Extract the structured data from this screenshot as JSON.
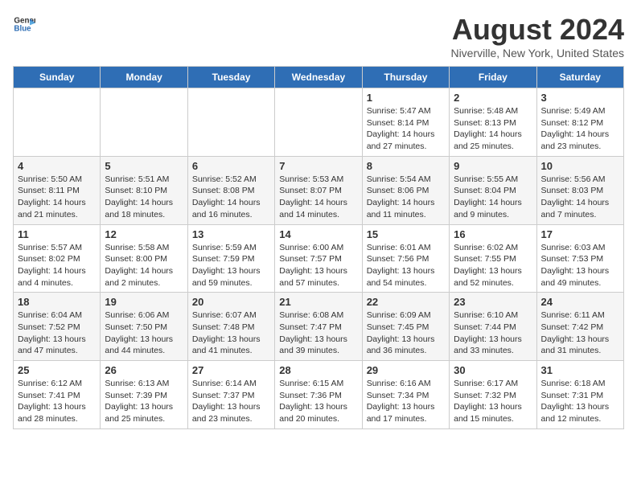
{
  "header": {
    "logo_line1": "General",
    "logo_line2": "Blue",
    "month_year": "August 2024",
    "location": "Niverville, New York, United States"
  },
  "weekdays": [
    "Sunday",
    "Monday",
    "Tuesday",
    "Wednesday",
    "Thursday",
    "Friday",
    "Saturday"
  ],
  "weeks": [
    [
      {
        "day": "",
        "info": ""
      },
      {
        "day": "",
        "info": ""
      },
      {
        "day": "",
        "info": ""
      },
      {
        "day": "",
        "info": ""
      },
      {
        "day": "1",
        "info": "Sunrise: 5:47 AM\nSunset: 8:14 PM\nDaylight: 14 hours\nand 27 minutes."
      },
      {
        "day": "2",
        "info": "Sunrise: 5:48 AM\nSunset: 8:13 PM\nDaylight: 14 hours\nand 25 minutes."
      },
      {
        "day": "3",
        "info": "Sunrise: 5:49 AM\nSunset: 8:12 PM\nDaylight: 14 hours\nand 23 minutes."
      }
    ],
    [
      {
        "day": "4",
        "info": "Sunrise: 5:50 AM\nSunset: 8:11 PM\nDaylight: 14 hours\nand 21 minutes."
      },
      {
        "day": "5",
        "info": "Sunrise: 5:51 AM\nSunset: 8:10 PM\nDaylight: 14 hours\nand 18 minutes."
      },
      {
        "day": "6",
        "info": "Sunrise: 5:52 AM\nSunset: 8:08 PM\nDaylight: 14 hours\nand 16 minutes."
      },
      {
        "day": "7",
        "info": "Sunrise: 5:53 AM\nSunset: 8:07 PM\nDaylight: 14 hours\nand 14 minutes."
      },
      {
        "day": "8",
        "info": "Sunrise: 5:54 AM\nSunset: 8:06 PM\nDaylight: 14 hours\nand 11 minutes."
      },
      {
        "day": "9",
        "info": "Sunrise: 5:55 AM\nSunset: 8:04 PM\nDaylight: 14 hours\nand 9 minutes."
      },
      {
        "day": "10",
        "info": "Sunrise: 5:56 AM\nSunset: 8:03 PM\nDaylight: 14 hours\nand 7 minutes."
      }
    ],
    [
      {
        "day": "11",
        "info": "Sunrise: 5:57 AM\nSunset: 8:02 PM\nDaylight: 14 hours\nand 4 minutes."
      },
      {
        "day": "12",
        "info": "Sunrise: 5:58 AM\nSunset: 8:00 PM\nDaylight: 14 hours\nand 2 minutes."
      },
      {
        "day": "13",
        "info": "Sunrise: 5:59 AM\nSunset: 7:59 PM\nDaylight: 13 hours\nand 59 minutes."
      },
      {
        "day": "14",
        "info": "Sunrise: 6:00 AM\nSunset: 7:57 PM\nDaylight: 13 hours\nand 57 minutes."
      },
      {
        "day": "15",
        "info": "Sunrise: 6:01 AM\nSunset: 7:56 PM\nDaylight: 13 hours\nand 54 minutes."
      },
      {
        "day": "16",
        "info": "Sunrise: 6:02 AM\nSunset: 7:55 PM\nDaylight: 13 hours\nand 52 minutes."
      },
      {
        "day": "17",
        "info": "Sunrise: 6:03 AM\nSunset: 7:53 PM\nDaylight: 13 hours\nand 49 minutes."
      }
    ],
    [
      {
        "day": "18",
        "info": "Sunrise: 6:04 AM\nSunset: 7:52 PM\nDaylight: 13 hours\nand 47 minutes."
      },
      {
        "day": "19",
        "info": "Sunrise: 6:06 AM\nSunset: 7:50 PM\nDaylight: 13 hours\nand 44 minutes."
      },
      {
        "day": "20",
        "info": "Sunrise: 6:07 AM\nSunset: 7:48 PM\nDaylight: 13 hours\nand 41 minutes."
      },
      {
        "day": "21",
        "info": "Sunrise: 6:08 AM\nSunset: 7:47 PM\nDaylight: 13 hours\nand 39 minutes."
      },
      {
        "day": "22",
        "info": "Sunrise: 6:09 AM\nSunset: 7:45 PM\nDaylight: 13 hours\nand 36 minutes."
      },
      {
        "day": "23",
        "info": "Sunrise: 6:10 AM\nSunset: 7:44 PM\nDaylight: 13 hours\nand 33 minutes."
      },
      {
        "day": "24",
        "info": "Sunrise: 6:11 AM\nSunset: 7:42 PM\nDaylight: 13 hours\nand 31 minutes."
      }
    ],
    [
      {
        "day": "25",
        "info": "Sunrise: 6:12 AM\nSunset: 7:41 PM\nDaylight: 13 hours\nand 28 minutes."
      },
      {
        "day": "26",
        "info": "Sunrise: 6:13 AM\nSunset: 7:39 PM\nDaylight: 13 hours\nand 25 minutes."
      },
      {
        "day": "27",
        "info": "Sunrise: 6:14 AM\nSunset: 7:37 PM\nDaylight: 13 hours\nand 23 minutes."
      },
      {
        "day": "28",
        "info": "Sunrise: 6:15 AM\nSunset: 7:36 PM\nDaylight: 13 hours\nand 20 minutes."
      },
      {
        "day": "29",
        "info": "Sunrise: 6:16 AM\nSunset: 7:34 PM\nDaylight: 13 hours\nand 17 minutes."
      },
      {
        "day": "30",
        "info": "Sunrise: 6:17 AM\nSunset: 7:32 PM\nDaylight: 13 hours\nand 15 minutes."
      },
      {
        "day": "31",
        "info": "Sunrise: 6:18 AM\nSunset: 7:31 PM\nDaylight: 13 hours\nand 12 minutes."
      }
    ]
  ]
}
